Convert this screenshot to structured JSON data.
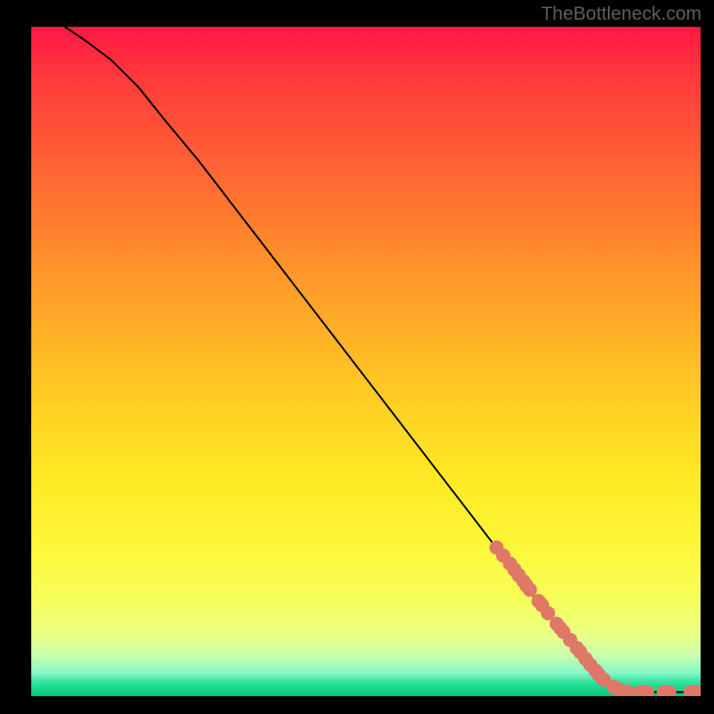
{
  "watermark": "TheBottleneck.com",
  "chart_data": {
    "type": "line",
    "title": "",
    "xlabel": "",
    "ylabel": "",
    "xlim": [
      0,
      100
    ],
    "ylim": [
      0,
      100
    ],
    "curve": [
      {
        "x": 5,
        "y": 100
      },
      {
        "x": 8,
        "y": 98
      },
      {
        "x": 12,
        "y": 95
      },
      {
        "x": 16,
        "y": 91
      },
      {
        "x": 20,
        "y": 86
      },
      {
        "x": 25,
        "y": 80
      },
      {
        "x": 30,
        "y": 73.5
      },
      {
        "x": 35,
        "y": 67
      },
      {
        "x": 40,
        "y": 60.5
      },
      {
        "x": 45,
        "y": 54
      },
      {
        "x": 50,
        "y": 47.5
      },
      {
        "x": 55,
        "y": 41
      },
      {
        "x": 60,
        "y": 34.5
      },
      {
        "x": 65,
        "y": 28
      },
      {
        "x": 70,
        "y": 21.5
      },
      {
        "x": 75,
        "y": 15
      },
      {
        "x": 80,
        "y": 9
      },
      {
        "x": 84,
        "y": 4
      },
      {
        "x": 87,
        "y": 1.5
      },
      {
        "x": 89,
        "y": 0.8
      },
      {
        "x": 92,
        "y": 0.6
      },
      {
        "x": 95,
        "y": 0.6
      },
      {
        "x": 98,
        "y": 0.6
      },
      {
        "x": 100,
        "y": 0.6
      }
    ],
    "scatter_points": [
      {
        "x": 69.5,
        "y": 22.2
      },
      {
        "x": 70.5,
        "y": 21.0
      },
      {
        "x": 71.5,
        "y": 19.8
      },
      {
        "x": 72.2,
        "y": 18.9
      },
      {
        "x": 72.8,
        "y": 18.1
      },
      {
        "x": 73.5,
        "y": 17.2
      },
      {
        "x": 74.0,
        "y": 16.5
      },
      {
        "x": 74.5,
        "y": 15.9
      },
      {
        "x": 75.8,
        "y": 14.2
      },
      {
        "x": 76.3,
        "y": 13.6
      },
      {
        "x": 77.2,
        "y": 12.4
      },
      {
        "x": 78.5,
        "y": 10.8
      },
      {
        "x": 79.0,
        "y": 10.2
      },
      {
        "x": 79.5,
        "y": 9.6
      },
      {
        "x": 80.5,
        "y": 8.4
      },
      {
        "x": 81.5,
        "y": 7.2
      },
      {
        "x": 82.0,
        "y": 6.6
      },
      {
        "x": 82.8,
        "y": 5.6
      },
      {
        "x": 83.5,
        "y": 4.7
      },
      {
        "x": 84.3,
        "y": 3.8
      },
      {
        "x": 84.8,
        "y": 3.2
      },
      {
        "x": 85.5,
        "y": 2.5
      },
      {
        "x": 87.0,
        "y": 1.4
      },
      {
        "x": 87.8,
        "y": 1.0
      },
      {
        "x": 89.0,
        "y": 0.7
      },
      {
        "x": 91.0,
        "y": 0.6
      },
      {
        "x": 92.0,
        "y": 0.6
      },
      {
        "x": 94.5,
        "y": 0.6
      },
      {
        "x": 95.3,
        "y": 0.6
      },
      {
        "x": 98.5,
        "y": 0.6
      },
      {
        "x": 99.5,
        "y": 0.6
      }
    ],
    "colors": {
      "curve": "#000000",
      "points": "#e07868",
      "gradient_top": "#ff1744",
      "gradient_bottom": "#00c97a"
    }
  }
}
